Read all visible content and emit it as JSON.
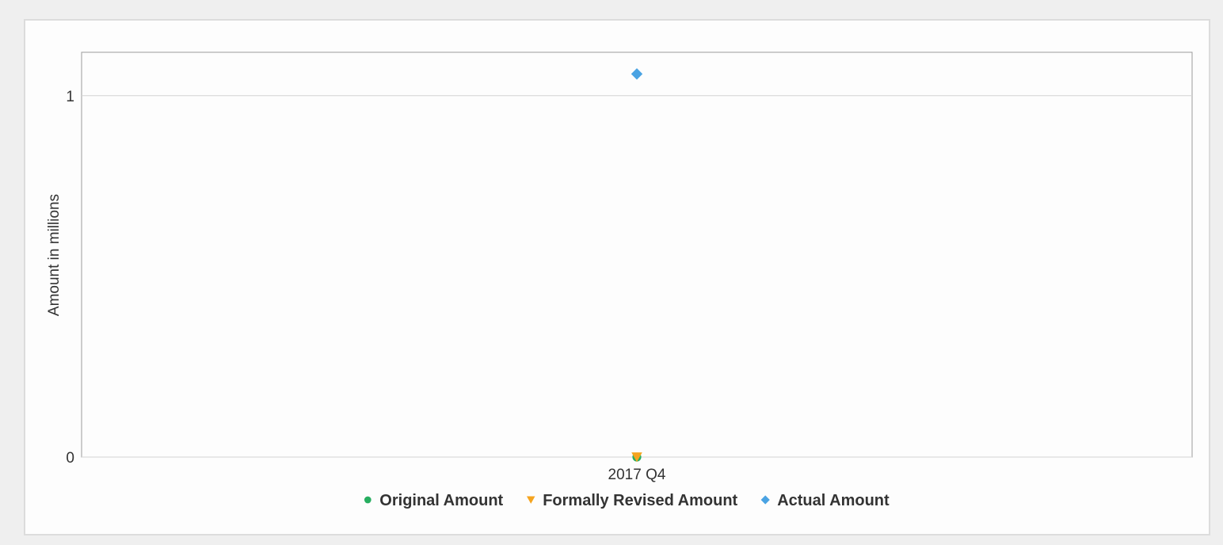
{
  "chart_data": {
    "type": "scatter",
    "categories": [
      "2017 Q4"
    ],
    "ylabel": "Amount in millions",
    "xlabel": "",
    "ylim": [
      0,
      1.12
    ],
    "y_ticks": [
      "0",
      "1"
    ],
    "grid": true,
    "legend_position": "bottom",
    "series": [
      {
        "name": "Original Amount",
        "marker": "circle",
        "color": "#27ae60",
        "values": [
          0
        ]
      },
      {
        "name": "Formally Revised Amount",
        "marker": "triangle-down",
        "color": "#f5a41f",
        "values": [
          0
        ]
      },
      {
        "name": "Actual Amount",
        "marker": "diamond",
        "color": "#4aa3e3",
        "values": [
          1.06
        ]
      }
    ]
  }
}
